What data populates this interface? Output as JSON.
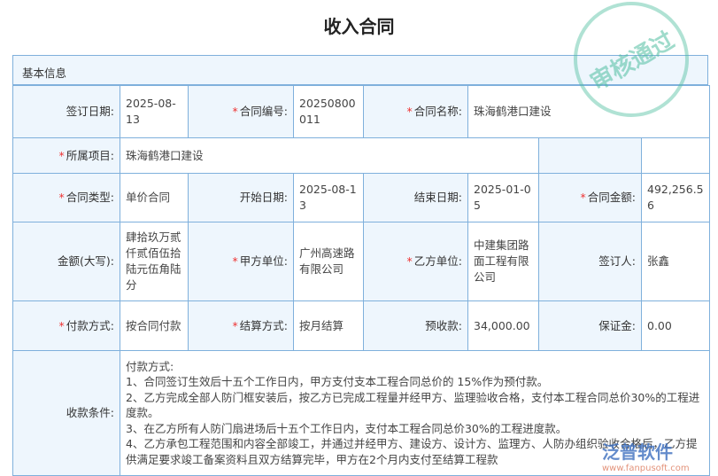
{
  "title": "收入合同",
  "section": "基本信息",
  "fields": {
    "sign_date": {
      "label": "签订日期:",
      "value": "2025-08-13"
    },
    "contract_no": {
      "label": "合同编号:",
      "value": "20250800011"
    },
    "contract_name": {
      "label": "合同名称:",
      "value": "珠海鹤港口建设"
    },
    "project": {
      "label": "所属项目:",
      "value": "珠海鹤港口建设"
    },
    "contract_type": {
      "label": "合同类型:",
      "value": "单价合同"
    },
    "start_date": {
      "label": "开始日期:",
      "value": "2025-08-13"
    },
    "end_date": {
      "label": "结束日期:",
      "value": "2025-01-05"
    },
    "amount": {
      "label": "合同金额:",
      "value": "492,256.56"
    },
    "amount_caps": {
      "label": "金额(大写):",
      "value": "肆拾玖万贰仟贰佰伍拾陆元伍角陆分"
    },
    "party_a": {
      "label": "甲方单位:",
      "value": "广州高速路有限公司"
    },
    "party_b": {
      "label": "乙方单位:",
      "value": "中建集团路面工程有限公司"
    },
    "signer": {
      "label": "签订人:",
      "value": "张鑫"
    },
    "payment_method": {
      "label": "付款方式:",
      "value": "按合同付款"
    },
    "settle_method": {
      "label": "结算方式:",
      "value": "按月结算"
    },
    "prepay": {
      "label": "预收款:",
      "value": "34,000.00"
    },
    "deposit": {
      "label": "保证金:",
      "value": "0.00"
    },
    "terms": {
      "label": "收款条件:",
      "lines": [
        "付款方式:",
        "1、合同签订生效后十五个工作日内，甲方支付支本工程合同总价的 15%作为预付款。",
        "2、乙方完成全部人防门框安装后，按乙方已完成工程量并经甲方、监理验收合格，支付本工程合同总价30%的工程进度款。",
        "3、在乙方所有人防门扇进场后十五个工作日内，支付本工程合同总价30%的工程进度款。",
        "4、乙方承包工程范围和内容全部竣工，并通过并经甲方、建设方、设计方、监理方、人防办组织验收合格后，乙方提供满足要求竣工备案资料且双方结算完毕，甲方在2个月内支付至结算工程款"
      ]
    }
  },
  "stamp": "审核通过",
  "watermark": {
    "brand": "泛普软件",
    "url": "www.fanpusoft.com"
  }
}
